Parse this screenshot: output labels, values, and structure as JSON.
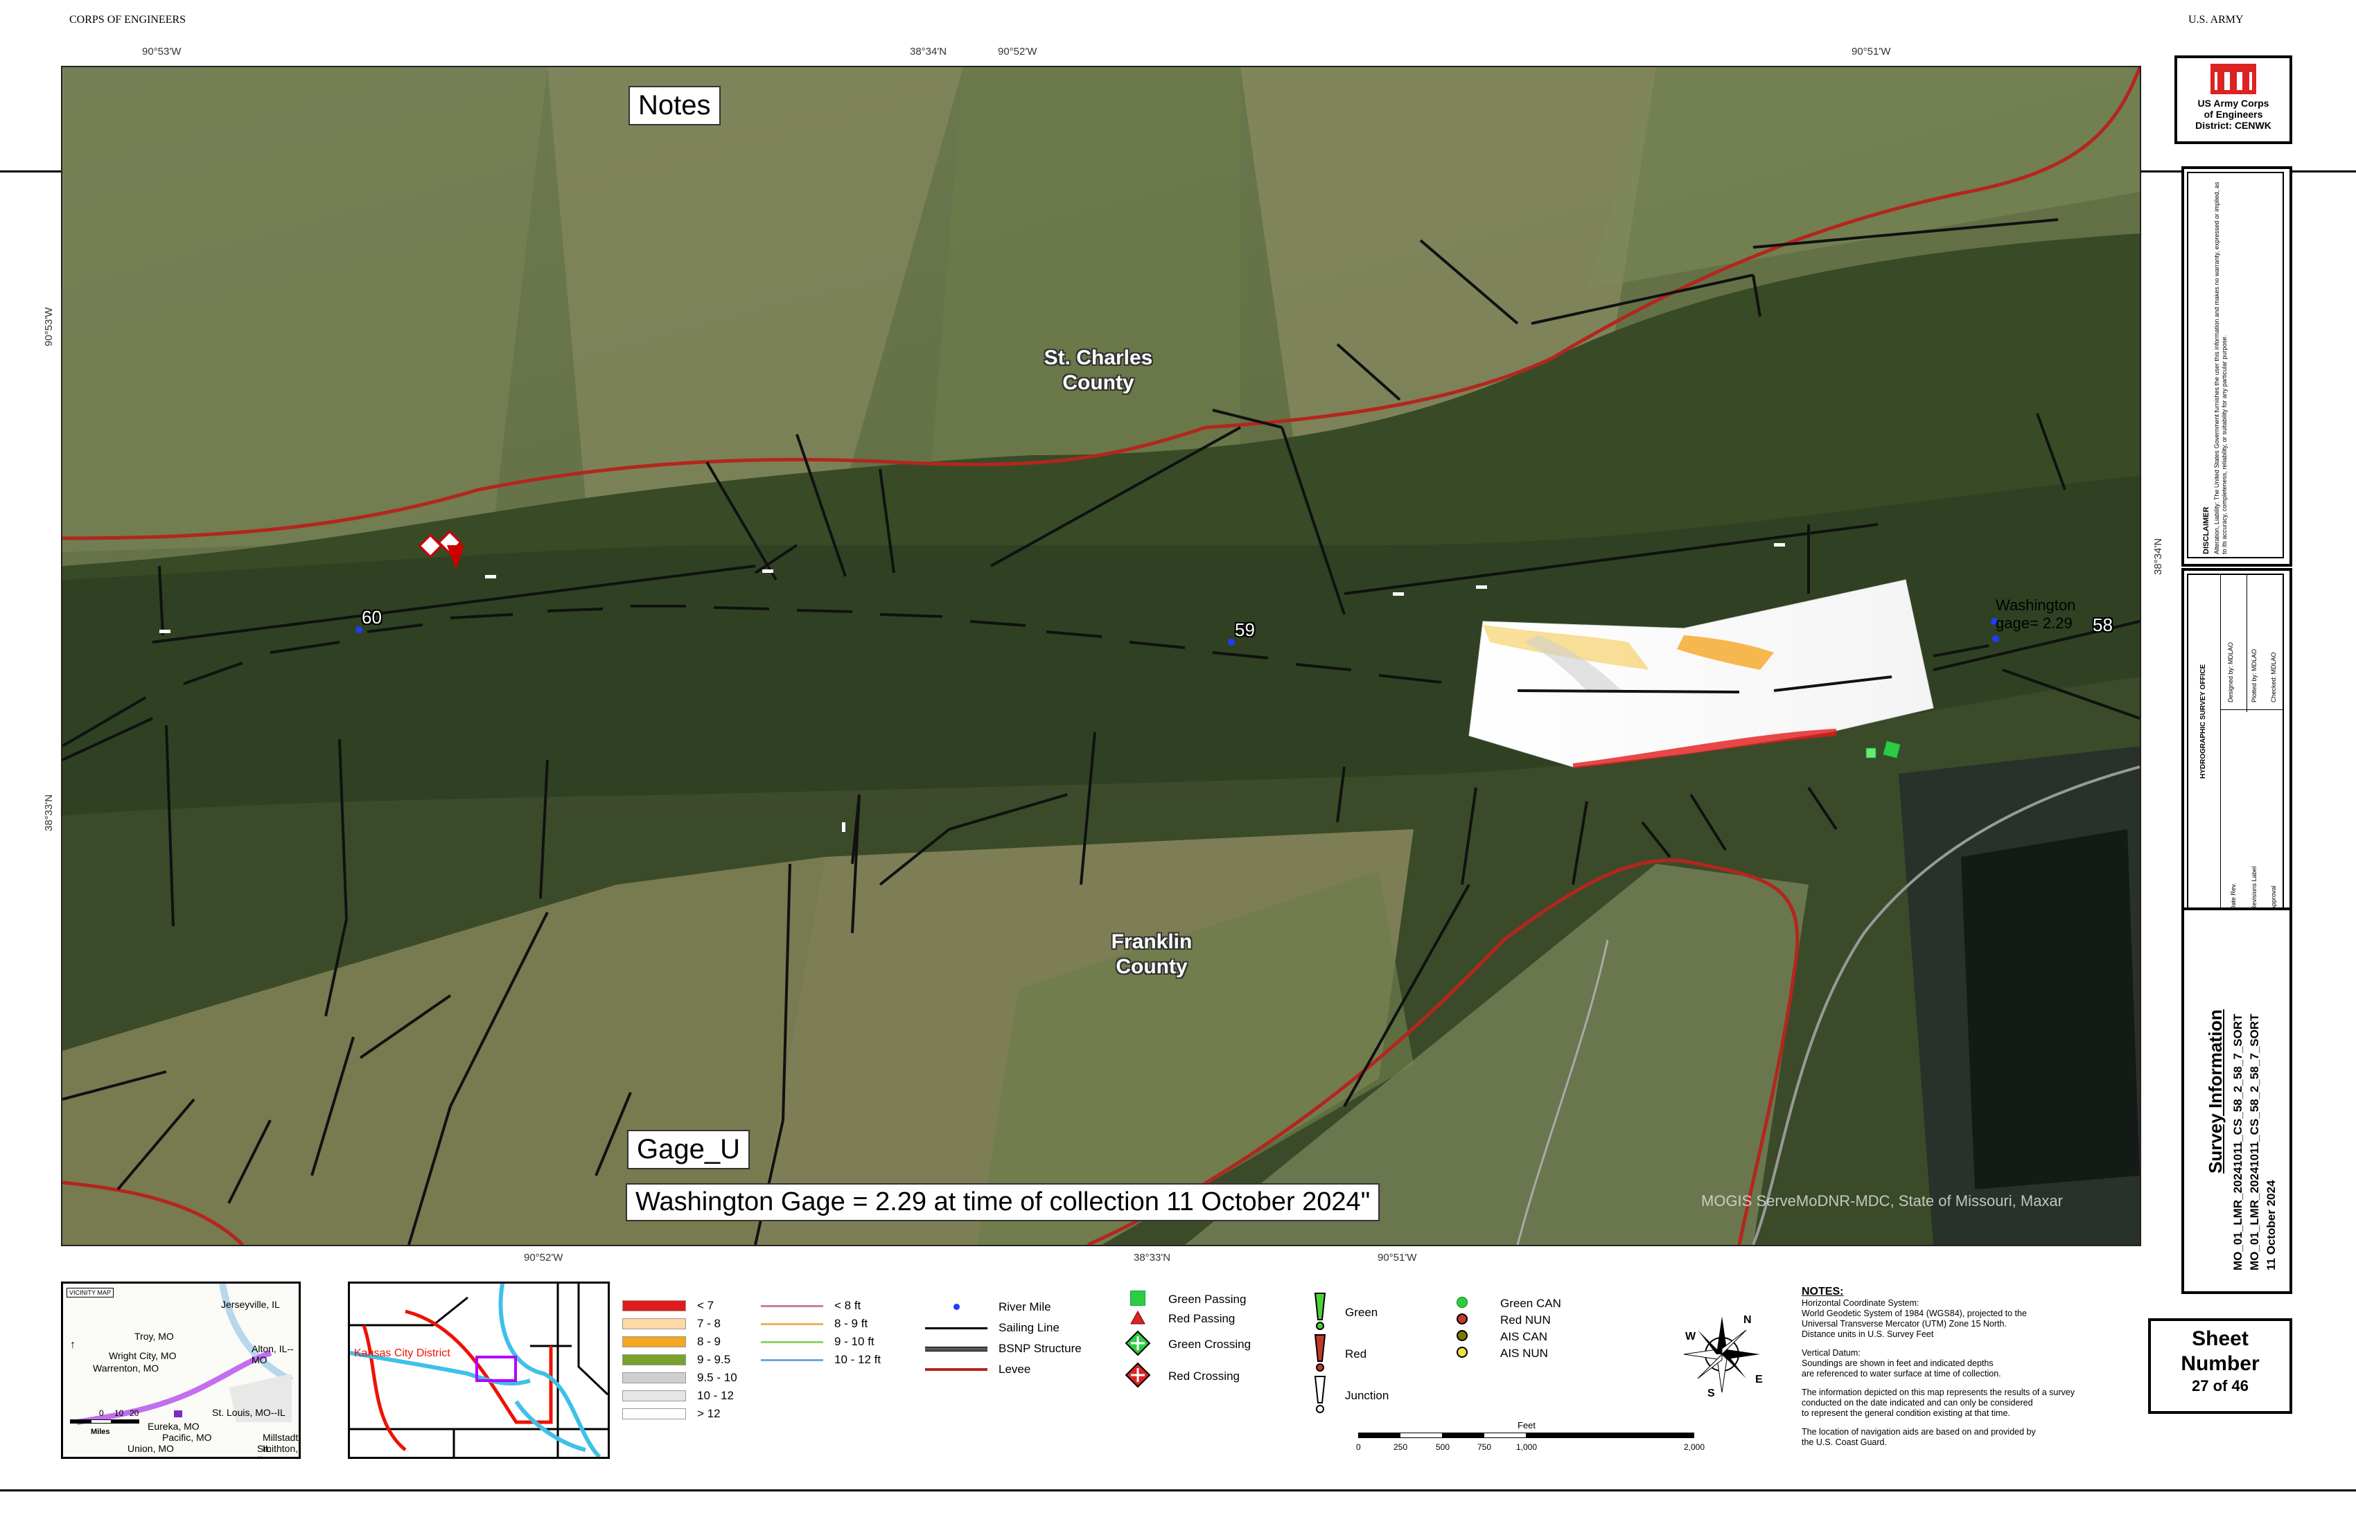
{
  "header": {
    "left": "CORPS OF ENGINEERS",
    "right": "U.S. ARMY"
  },
  "ticks": {
    "top": [
      "90°53'W",
      "38°34'N",
      "90°52'W",
      "90°51'W"
    ],
    "bottom": [
      "90°52'W",
      "38°33'N",
      "90°51'W"
    ],
    "left": [
      "90°53'W",
      "38°33'N"
    ],
    "right": [
      "38°34'N"
    ]
  },
  "map": {
    "notes_label": "Notes",
    "gage_label": "Gage_U",
    "gage_note": "Washington Gage = 2.29 at time of collection 11 October 2024\"",
    "county_north": [
      "St. Charles",
      "County"
    ],
    "county_south": [
      "Franklin",
      "County"
    ],
    "river_miles": [
      "60",
      "59",
      "58"
    ],
    "washington_gage": [
      "Washington",
      "gage= 2.29"
    ],
    "credit": "MOGIS ServeMoDNR-MDC, State of Missouri, Maxar"
  },
  "logo": {
    "lines": [
      "US Army Corps",
      "of Engineers",
      "District: CENWK"
    ]
  },
  "survey": {
    "title": "Survey Information",
    "line1": "MO_01_LMR_20241011_CS_58_2_58_7_SORT",
    "line2": "MO_01_LMR_20241011_CS_58_2_58_7_SORT",
    "date": "11 October 2024"
  },
  "sheet": {
    "line1": "Sheet",
    "line2": "Number",
    "line3": "27 of 46"
  },
  "vicinity": {
    "title": "VICINITY MAP",
    "places": [
      "Jerseyville, IL",
      "Troy, MO",
      "Alton, IL--MO",
      "Wright City, MO",
      "Warrenton, MO",
      "St. Louis, MO--IL",
      "Eureka, MO",
      "Pacific, MO",
      "Union, MO",
      "Millstadt, IL",
      "Smithton, IL"
    ],
    "scale": [
      "0",
      "10",
      "20"
    ],
    "scale_unit": "Miles"
  },
  "district_inset": {
    "label": "Kansas City District"
  },
  "depth_legend": [
    {
      "label": "< 7",
      "color": "#e31a1c"
    },
    {
      "label": "7 - 8",
      "color": "#fdd9a6"
    },
    {
      "label": "8 - 9",
      "color": "#f5a623"
    },
    {
      "label": "9 - 9.5",
      "color": "#7aa12b"
    },
    {
      "label": "9.5 - 10",
      "color": "#cfcfcf"
    },
    {
      "label": "10 - 12",
      "color": "#e6e6e6"
    },
    {
      "label": "> 12",
      "color": "#ffffff"
    }
  ],
  "contour_legend": [
    {
      "label": "< 8 ft",
      "color": "#c97fa0"
    },
    {
      "label": "8 - 9 ft",
      "color": "#f0b060"
    },
    {
      "label": "9 - 10 ft",
      "color": "#8fd36b"
    },
    {
      "label": "10 - 12 ft",
      "color": "#6aa8e0"
    }
  ],
  "line_legend": [
    "River Mile",
    "Sailing Line",
    "BSNP Structure",
    "Levee"
  ],
  "crossing_legend": [
    "Green Passing",
    "Red Passing",
    "Green Crossing",
    "Red Crossing"
  ],
  "buoy_legend": [
    "Green",
    "Red",
    "Junction"
  ],
  "ais_legend": [
    "Green CAN",
    "Red NUN",
    "AIS CAN",
    "AIS NUN"
  ],
  "notes": {
    "title": "NOTES:",
    "lines": [
      "Horizontal Coordinate System:",
      "World Geodetic System of 1984 (WGS84), projected to the",
      "Universal Transverse Mercator (UTM) Zone 15 North.",
      "Distance units in U.S. Survey Feet",
      "",
      "Vertical Datum:",
      "Soundings are shown in feet and indicated depths",
      "are referenced to water surface at time of collection.",
      "",
      "The information depicted on this map represents the results of a survey",
      "conducted on the date indicated and can only be considered",
      "to represent the general condition existing at that time.",
      "",
      "The location of navigation aids are based on and provided by",
      "the U.S. Coast Guard."
    ]
  },
  "scale_bar": {
    "unit": "Feet",
    "ticks": [
      "0",
      "250",
      "500",
      "750",
      "1,000",
      "2,000"
    ]
  },
  "disclaimer": {
    "title": "DISCLAIMER",
    "text": "Alteration, Liability: The United States Government furnishes the user this information and makes no warranty, expressed or implied, as to its accuracy, completeness, reliability, or suitability for any particular purpose."
  },
  "signature": {
    "office": "HYDROGRAPHIC SURVEY OFFICE",
    "rows": [
      "Date Rev.",
      "Revisions Label",
      "Approval"
    ],
    "cols": [
      "Designed by: MDLAO",
      "Plotted by: MDLAO",
      "Checked: MDLAO"
    ]
  }
}
